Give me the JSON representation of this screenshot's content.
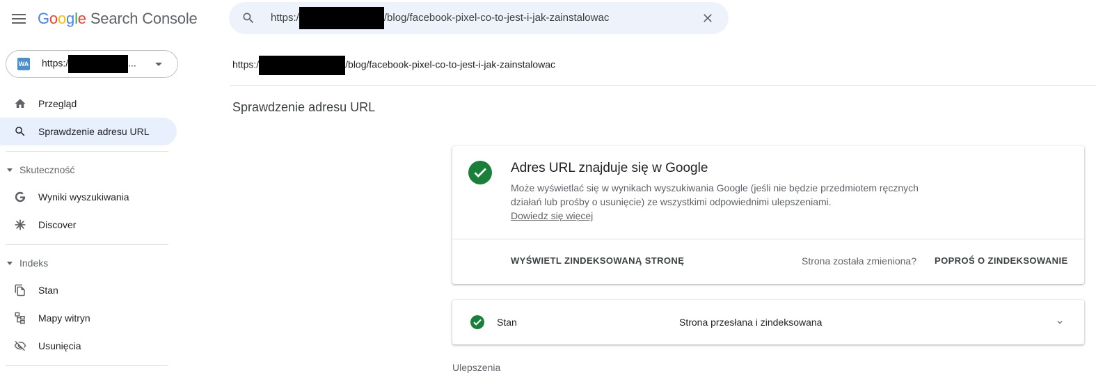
{
  "header": {
    "logo_letters": [
      "G",
      "o",
      "o",
      "g",
      "l",
      "e"
    ],
    "product": "Search Console",
    "search_value_prefix": "https:/",
    "search_value_suffix": "/blog/facebook-pixel-co-to-jest-i-jak-zainstalowac"
  },
  "sidebar": {
    "property_icon_text": "WA",
    "property_prefix": "https:/",
    "property_suffix": "...",
    "nav_top": [
      {
        "label": "Przegląd",
        "icon": "home-icon"
      },
      {
        "label": "Sprawdzenie adresu URL",
        "icon": "search-icon",
        "active": true
      }
    ],
    "sections": [
      {
        "title": "Skuteczność",
        "items": [
          {
            "label": "Wyniki wyszukiwania",
            "icon": "google-g-icon"
          },
          {
            "label": "Discover",
            "icon": "asterisk-icon"
          }
        ]
      },
      {
        "title": "Indeks",
        "items": [
          {
            "label": "Stan",
            "icon": "pages-icon"
          },
          {
            "label": "Mapy witryn",
            "icon": "sitemap-icon"
          },
          {
            "label": "Usunięcia",
            "icon": "eye-off-icon"
          }
        ]
      }
    ]
  },
  "main": {
    "url_prefix": "https:/",
    "url_suffix": "/blog/facebook-pixel-co-to-jest-i-jak-zainstalowac",
    "page_title": "Sprawdzenie adresu URL",
    "card": {
      "title": "Adres URL znajduje się w Google",
      "description": "Może wyświetlać się w wynikach wyszukiwania Google (jeśli nie będzie przedmiotem ręcznych działań lub prośby o usunięcie) ze wszystkimi odpowiednimi ulepszeniami.",
      "learn_more": "Dowiedz się więcej",
      "view_indexed": "WYŚWIETL ZINDEKSOWANĄ STRONĘ",
      "changed_question": "Strona została zmieniona?",
      "request_indexing": "POPROŚ O ZINDEKSOWANIE"
    },
    "status": {
      "label": "Stan",
      "value": "Strona przesłana i zindeksowana"
    },
    "enhancements_label": "Ulepszenia"
  },
  "colors": {
    "accent_active": "#e8f0fe",
    "success_green": "#188038",
    "search_bg": "#eef3fb"
  }
}
